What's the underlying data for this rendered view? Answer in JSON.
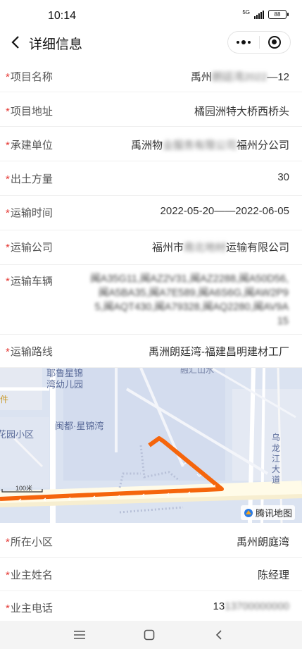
{
  "status": {
    "time": "10:14",
    "network": "5G",
    "battery": "88"
  },
  "nav": {
    "title": "详细信息"
  },
  "fields": [
    {
      "label": "项目名称",
      "value": "禹州朗廷湾2022—12"
    },
    {
      "label": "项目地址",
      "value": "橘园洲特大桥西桥头"
    },
    {
      "label": "承建单位",
      "value": "禹洲物业服务有限公司福州分公司"
    },
    {
      "label": "出土方量",
      "value": "30"
    },
    {
      "label": "运输时间",
      "value": "2022-05-20——2022-06-05"
    },
    {
      "label": "运输公司",
      "value": "福州市南北地材运输有限公司"
    },
    {
      "label": "运输车辆",
      "value": "闽A35G11,闽AZ2V31,闽AZ2288,闽A50D56,闽A5BA35,闽A7E589,闽A6S6G,闽AW2P95,闽AQT430,闽A79328,闽AQ2280,闽AV9A15"
    },
    {
      "label": "运输路线",
      "value": "禹洲朗廷湾-福建昌明建材工厂"
    }
  ],
  "owner_fields": [
    {
      "label": "所在小区",
      "value": "禹州朗庭湾"
    },
    {
      "label": "业主姓名",
      "value": "陈经理"
    },
    {
      "label": "业主电话",
      "value": "13700000000"
    }
  ],
  "map": {
    "labels": {
      "kindergarten_1": "耶鲁星锦",
      "kindergarten_2": "湾幼儿园",
      "community": "闽都·星锦湾",
      "garden_community": "花园小区",
      "river": "融汇山水",
      "wulong_1": "乌",
      "wulong_2": "龙",
      "wulong_3": "江",
      "wulong_4": "大",
      "wulong_5": "道",
      "edge_left": "件",
      "scale": "100米"
    },
    "logo_text": "腾讯地图",
    "route_color": "#f5650c"
  },
  "colors": {
    "required": "#e53935"
  }
}
